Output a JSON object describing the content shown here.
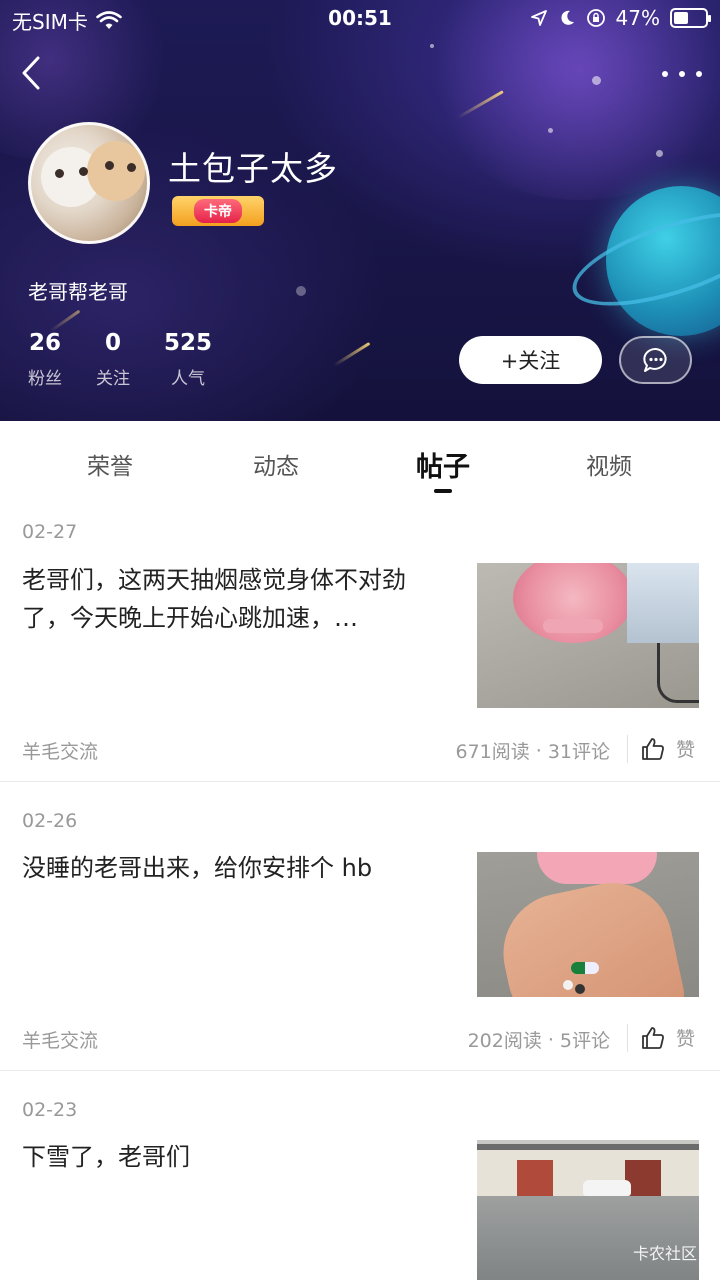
{
  "status_bar": {
    "carrier": "无SIM卡",
    "time": "00:51",
    "battery_percent": "47%",
    "battery_level": 0.47
  },
  "profile": {
    "username": "土包子太多",
    "badge_label": "卡帝",
    "bio": "老哥帮老哥",
    "stats": [
      {
        "value": "26",
        "label": "粉丝"
      },
      {
        "value": "0",
        "label": "关注"
      },
      {
        "value": "525",
        "label": "人气"
      }
    ],
    "follow_label": "+关注"
  },
  "tabs": [
    {
      "label": "荣誉",
      "active": false
    },
    {
      "label": "动态",
      "active": false
    },
    {
      "label": "帖子",
      "active": true
    },
    {
      "label": "视频",
      "active": false
    }
  ],
  "posts": [
    {
      "date": "02-27",
      "title": "老哥们，这两天抽烟感觉身体不对劲了，今天晚上开始心跳加速，…",
      "category": "羊毛交流",
      "reads": "671阅读",
      "comments": "31评论",
      "like_label": "赞"
    },
    {
      "date": "02-26",
      "title": "没睡的老哥出来，给你安排个 hb",
      "category": "羊毛交流",
      "reads": "202阅读",
      "comments": "5评论",
      "like_label": "赞"
    },
    {
      "date": "02-23",
      "title": "下雪了，老哥们",
      "watermark": "卡农社区"
    }
  ]
}
